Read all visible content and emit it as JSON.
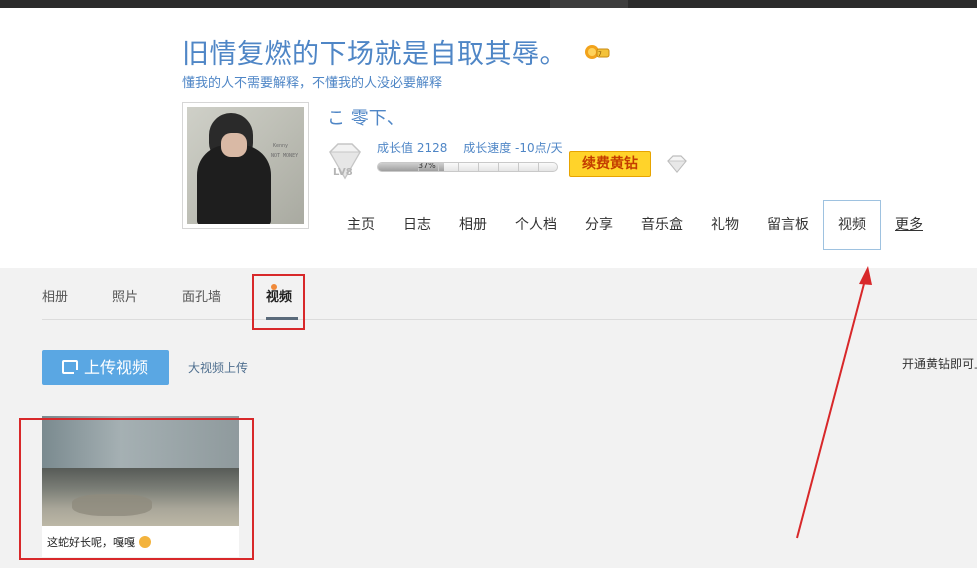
{
  "header": {
    "title": "旧情复燃的下场就是自取其辱。",
    "subtitle": "懂我的人不需要解释，不懂我的人没必要解释",
    "nickname": "こ 零下、",
    "level_label": "LV8",
    "growth_value_label": "成长值 2128",
    "growth_speed_label": "成长速度 -10点/天",
    "growth_progress_text": "37%",
    "growth_progress_fraction": 0.37,
    "renew_button": "续费黄钻",
    "avatar_shirt_text": "Kenny",
    "avatar_small_text": "NOT MONEY"
  },
  "nav": {
    "items": [
      {
        "label": "主页"
      },
      {
        "label": "日志"
      },
      {
        "label": "相册"
      },
      {
        "label": "个人档"
      },
      {
        "label": "分享"
      },
      {
        "label": "音乐盒"
      },
      {
        "label": "礼物"
      },
      {
        "label": "留言板"
      },
      {
        "label": "视频"
      },
      {
        "label": "更多"
      }
    ],
    "active_index": 8
  },
  "subtabs": {
    "items": [
      {
        "label": "相册"
      },
      {
        "label": "照片"
      },
      {
        "label": "面孔墙"
      },
      {
        "label": "视频"
      }
    ],
    "active_index": 3
  },
  "toolbar": {
    "upload_button": "上传视频",
    "big_upload_link": "大视频上传",
    "vip_tip": "开通黄钻即可上"
  },
  "videos": [
    {
      "caption": "这蛇好长呢，嘎嘎"
    }
  ],
  "colors": {
    "accent_blue": "#4f86c6",
    "upload_blue": "#5aa7e3",
    "vip_yellow": "#ffd32a",
    "annotation_red": "#d8282a"
  }
}
